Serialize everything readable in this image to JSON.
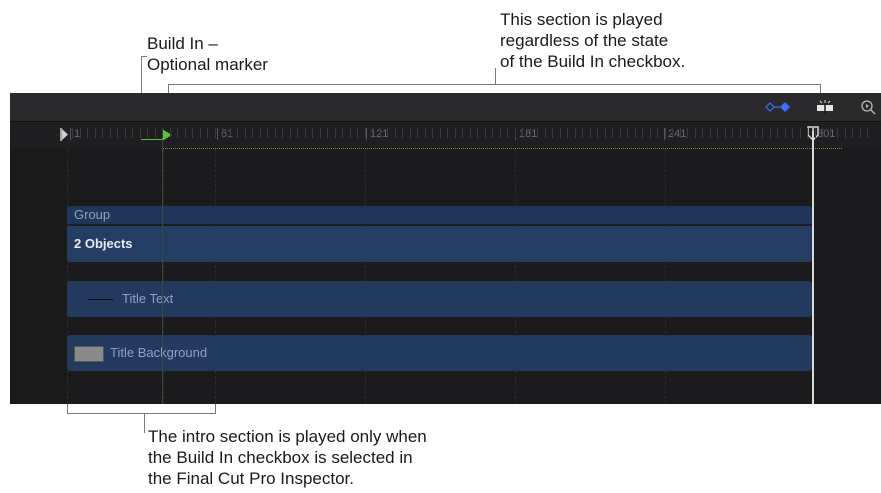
{
  "callouts": {
    "build_in": [
      "Build In –",
      "Optional marker"
    ],
    "played_regardless": [
      "This section is played",
      "regardless of the state",
      "of the Build In checkbox."
    ],
    "intro": [
      "The intro section is played only when",
      "the Build In checkbox is selected in",
      "the Final Cut Pro Inspector."
    ]
  },
  "ruler": {
    "labels": [
      "1",
      "61",
      "121",
      "181",
      "241",
      "301"
    ]
  },
  "tracks": {
    "group_label": "Group",
    "objects_label": "2 Objects",
    "title_text_label": "Title Text",
    "title_background_label": "Title Background"
  },
  "toolbar": {
    "icons": [
      "keyframe-diamond-icon",
      "snapping-icon",
      "zoom-icon"
    ]
  },
  "colors": {
    "accent_blue": "#3d6fff",
    "marker_green": "#5fbf3a",
    "track_blue": "#223a5e",
    "panel_bg": "#1b1b1d"
  }
}
